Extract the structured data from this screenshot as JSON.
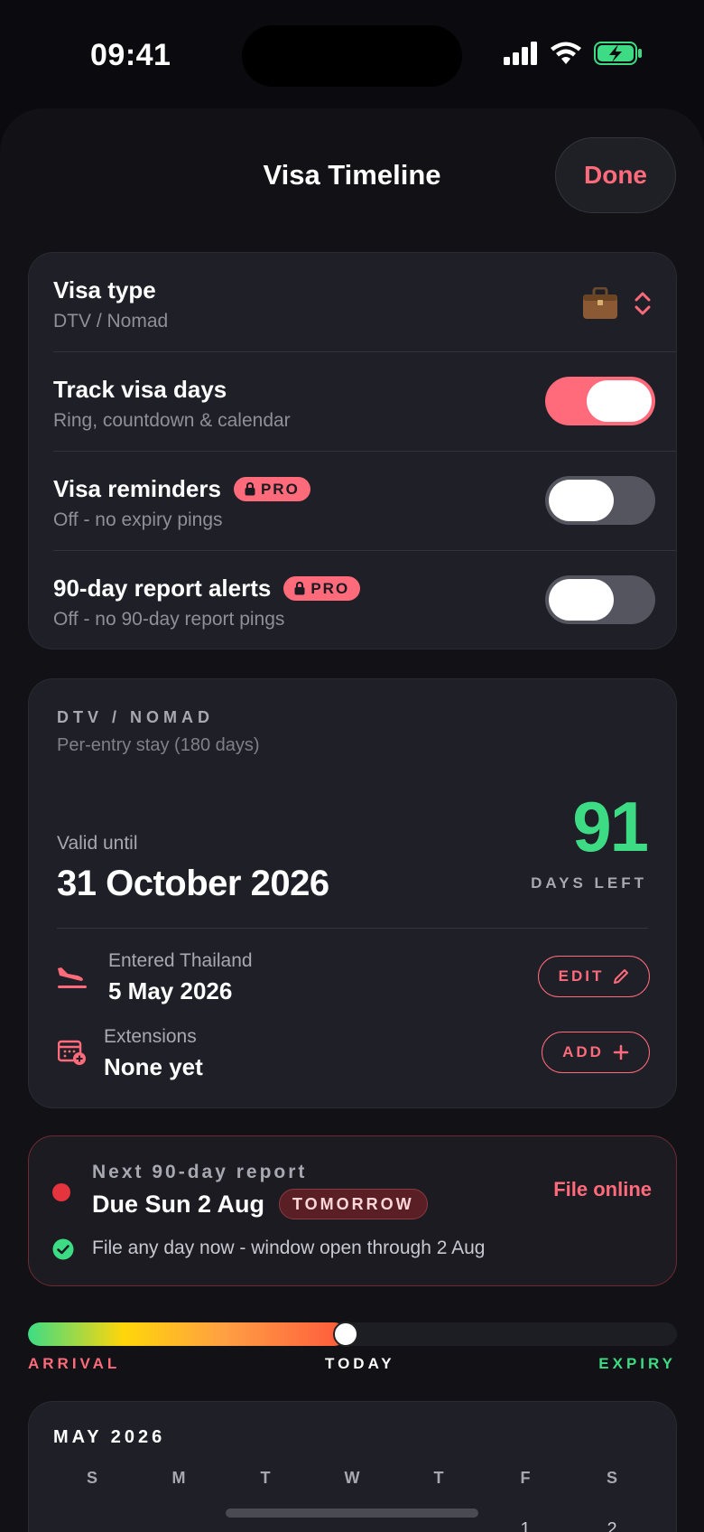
{
  "status_bar": {
    "time": "09:41"
  },
  "header": {
    "title": "Visa Timeline",
    "done_label": "Done"
  },
  "settings": {
    "visa_type": {
      "title": "Visa type",
      "subtitle": "DTV / Nomad",
      "icon": "briefcase-icon"
    },
    "track_days": {
      "title": "Track visa days",
      "subtitle": "Ring, countdown & calendar",
      "toggle_on": true
    },
    "reminders": {
      "title": "Visa reminders",
      "badge": "PRO",
      "subtitle": "Off - no expiry pings",
      "toggle_on": false
    },
    "report_alerts": {
      "title": "90-day report alerts",
      "badge": "PRO",
      "subtitle": "Off - no 90-day report pings",
      "toggle_on": false
    }
  },
  "detail": {
    "caption": "DTV / NOMAD",
    "subcaption": "Per-entry stay (180 days)",
    "valid_label": "Valid until",
    "valid_value": "31 October 2026",
    "days_number": "91",
    "days_label": "DAYS LEFT",
    "entered_label": "Entered Thailand",
    "entered_value": "5 May 2026",
    "edit_label": "EDIT",
    "extensions_label": "Extensions",
    "extensions_value": "None yet",
    "add_label": "ADD"
  },
  "report": {
    "caption": "Next 90-day report",
    "due": "Due Sun 2 Aug",
    "badge": "TOMORROW",
    "action": "File online",
    "note": "File any day now - window open through 2 Aug"
  },
  "timeline": {
    "progress": 0.49,
    "arrival_label": "ARRIVAL",
    "today_label": "TODAY",
    "expiry_label": "EXPIRY",
    "colors": {
      "arrival": "#ff6b7a",
      "today": "#ffffff",
      "expiry": "#3ddc84"
    }
  },
  "calendar": {
    "month": "MAY 2026",
    "weekdays": [
      "S",
      "M",
      "T",
      "W",
      "T",
      "F",
      "S"
    ],
    "first_days": [
      "1",
      "2"
    ]
  },
  "colors": {
    "accent": "#ff6b7a",
    "success": "#3ddc84",
    "danger": "#e5343d"
  }
}
